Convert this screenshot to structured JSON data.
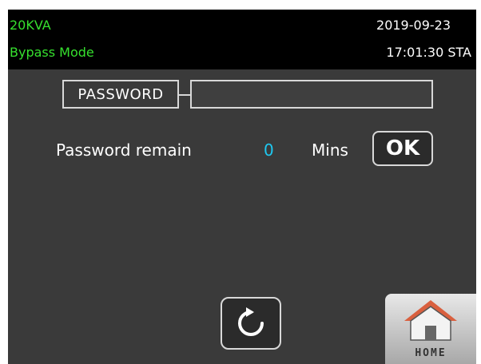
{
  "header": {
    "model": "20KVA",
    "mode": "Bypass Mode",
    "date": "2019-09-23",
    "time": "17:01:30 STA"
  },
  "password": {
    "label": "PASSWORD",
    "value": ""
  },
  "remain": {
    "label": "Password remain",
    "value": "0",
    "unit": "Mins"
  },
  "buttons": {
    "ok_label": "OK",
    "home_label": "HOME",
    "refresh_icon": "refresh-icon",
    "home_icon": "home-icon"
  },
  "colors": {
    "header_text_green": "#36e02e",
    "value_cyan": "#1ec8f0",
    "background": "#3a3a3a",
    "header_background": "#000000"
  }
}
